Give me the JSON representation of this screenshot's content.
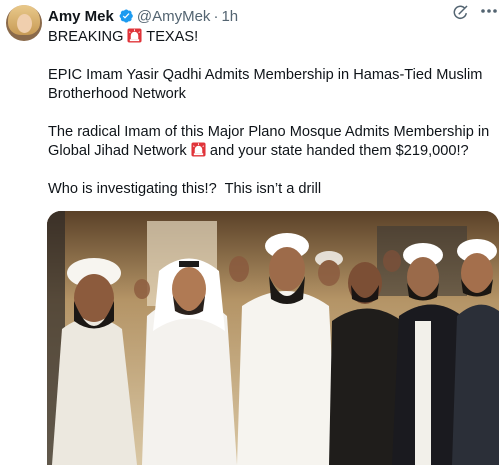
{
  "tweet": {
    "author_name": "Amy Mek",
    "author_handle": "@AmyMek",
    "separator": "·",
    "time": "1h",
    "line1_prefix": "BREAKING",
    "line1_suffix": "TEXAS!",
    "para1": "EPIC Imam Yasir Qadhi Admits Membership in Hamas-Tied Muslim Brotherhood Network",
    "para2_a": "The radical Imam of this Major Plano Mosque Admits Membership in Global Jihad Network",
    "para2_b": "and your state handed them $219,000!?",
    "para3": "Who is investigating this!?  This isn’t a drill"
  },
  "icons": {
    "verified": "verified-badge-icon",
    "grok": "grok-icon",
    "more": "more-icon",
    "siren": "rotating-light-emoji"
  },
  "colors": {
    "text": "#0f1419",
    "secondary": "#536471",
    "verified_blue": "#1d9bf0",
    "siren_red": "#e0343a"
  }
}
